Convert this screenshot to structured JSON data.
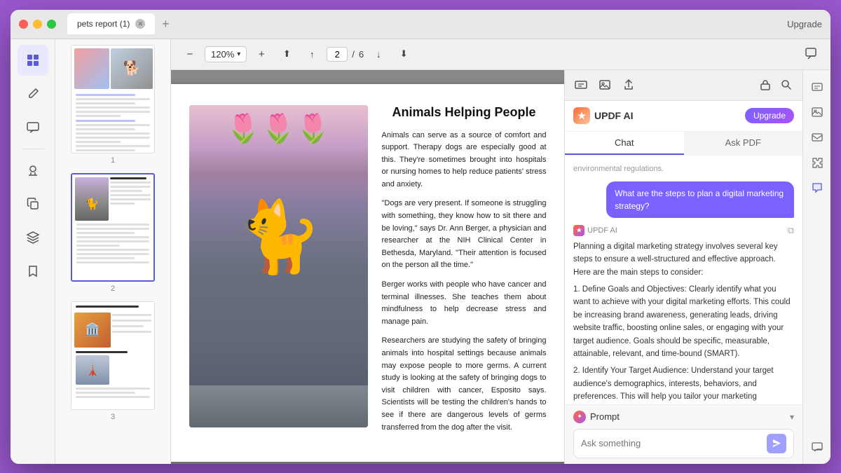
{
  "window": {
    "title": "pets report (1)",
    "upgrade_label": "Upgrade"
  },
  "toolbar": {
    "zoom_level": "120%",
    "page_current": "2",
    "page_total": "6"
  },
  "tabs": {
    "chat_label": "Chat",
    "askpdf_label": "Ask PDF"
  },
  "ai": {
    "title": "UPDF AI",
    "upgrade_btn": "Upgrade"
  },
  "chat": {
    "system_msg": "environmental regulations.",
    "user_msg": "What are the steps to plan a digital marketing strategy?",
    "ai_sender": "UPDF AI",
    "ai_response": "Planning a digital marketing strategy involves several key steps to ensure a well-structured and effective approach. Here are the main steps to consider:\n\n1. Define Goals and Objectives: Clearly identify what you want to achieve with your digital marketing efforts. This could be increasing brand awareness, generating leads, driving website traffic, boosting online sales, or engaging with your target audience. Goals should be specific, measurable, attainable, relevant, and time-bound (SMART).\n\n2. Identify Your Target Audience: Understand your target audience's demographics, interests, behaviors, and preferences. This will help you tailor your marketing messages and select appropriate digital channels to reach and engage..."
  },
  "prompt": {
    "label": "Prompt",
    "placeholder": "Ask something",
    "chevron": "▾"
  },
  "pdf": {
    "article_title": "Animals Helping People",
    "paragraph1": "Animals can serve as a source of comfort and support. Therapy dogs are especially good at this. They're sometimes brought into hospitals or nursing homes to help reduce patients' stress and anxiety.",
    "paragraph2": "\"Dogs are very present. If someone is struggling with something, they know how to sit there and be loving,\" says Dr. Ann Berger, a physician and researcher at the NIH Clinical Center in Bethesda, Maryland. \"Their attention is focused on the person all the time.\"",
    "paragraph3": "Berger works with people who have cancer and terminal illnesses. She teaches them about mindfulness to help decrease stress and manage pain.",
    "paragraph4": "Researchers are studying the safety of bringing animals into hospital settings because animals may expose people to more germs. A current study is looking at the safety of bringing dogs to visit children with cancer, Esposito says. Scientists will be testing the children's hands to see if there are dangerous levels of germs transferred from the dog after the visit."
  },
  "sidebar_icons": [
    "grid-icon",
    "pen-icon",
    "comment-icon",
    "stamp-icon",
    "copy-icon",
    "layers-icon",
    "bookmark-icon"
  ],
  "right_icons": [
    "scan-icon",
    "image-icon",
    "mail-icon",
    "puzzle-icon",
    "chat-icon"
  ]
}
